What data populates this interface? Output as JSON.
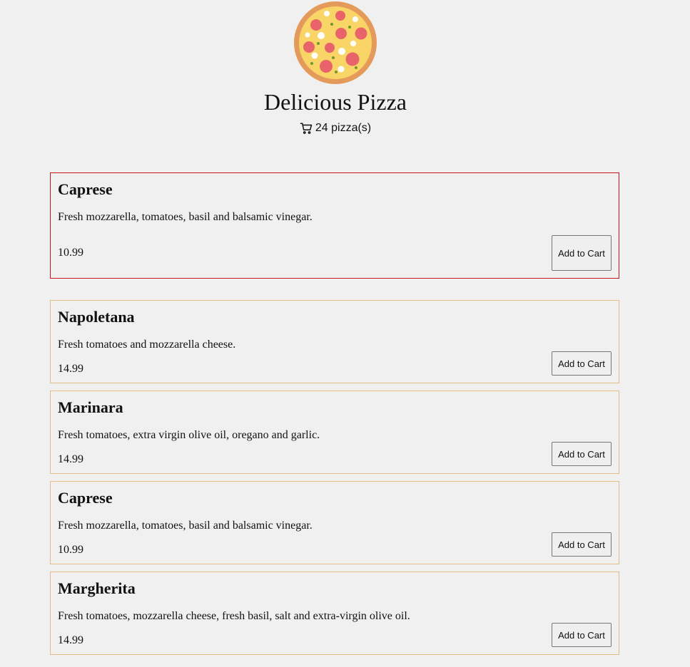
{
  "header": {
    "title": "Delicious Pizza",
    "cart_count_text": "24 pizza(s)",
    "logo_icon": "pizza-icon",
    "cart_icon": "cart-icon"
  },
  "colors": {
    "page_background": "#f0f0f0",
    "card_border": "#e2bd88",
    "selected_card_border": "#c61a1a"
  },
  "menu": {
    "items": [
      {
        "name": "Caprese",
        "description": "Fresh mozzarella, tomatoes, basil and balsamic vinegar.",
        "price": "10.99",
        "button": "Add to Cart",
        "selected": true
      },
      {
        "name": "Napoletana",
        "description": "Fresh tomatoes and mozzarella cheese.",
        "price": "14.99",
        "button": "Add to Cart",
        "selected": false
      },
      {
        "name": "Marinara",
        "description": "Fresh tomatoes, extra virgin olive oil, oregano and garlic.",
        "price": "14.99",
        "button": "Add to Cart",
        "selected": false
      },
      {
        "name": "Caprese",
        "description": "Fresh mozzarella, tomatoes, basil and balsamic vinegar.",
        "price": "10.99",
        "button": "Add to Cart",
        "selected": false
      },
      {
        "name": "Margherita",
        "description": "Fresh tomatoes, mozzarella cheese, fresh basil, salt and extra-virgin olive oil.",
        "price": "14.99",
        "button": "Add to Cart",
        "selected": false
      }
    ]
  }
}
